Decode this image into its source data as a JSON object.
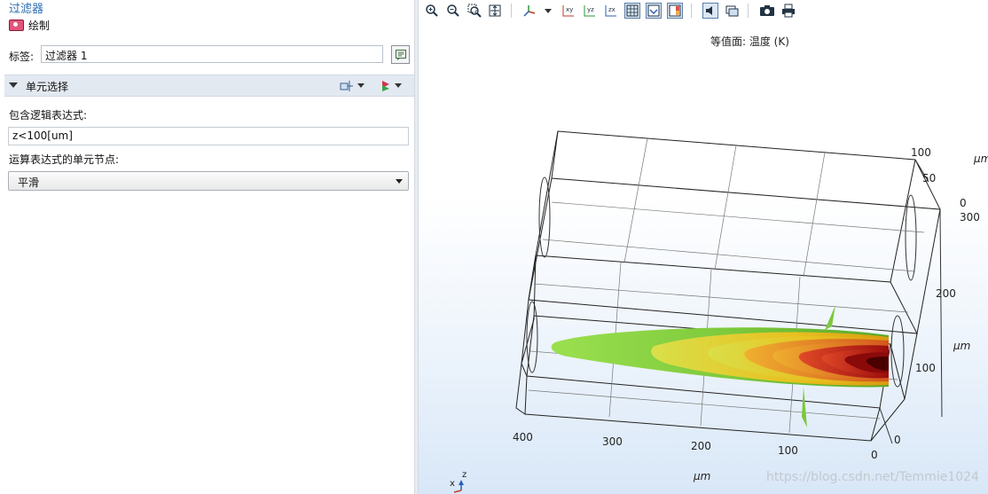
{
  "settings": {
    "panel_title": "过滤器",
    "plot_button": "绘制",
    "label_caption": "标签:",
    "label_value": "过滤器 1",
    "section_title": "单元选择",
    "logical_expr_caption": "包含逻辑表达式:",
    "logical_expr_value": "z<100[um]",
    "node_caption": "运算表达式的单元节点:",
    "node_value": "平滑"
  },
  "plot": {
    "title": "等值面: 温度 (K)",
    "x_ticks": [
      "400",
      "300",
      "200",
      "100",
      "0"
    ],
    "x_unit": "μm",
    "y_ticks": [
      "300",
      "200",
      "100",
      "0"
    ],
    "y_unit": "μm",
    "z_ticks": [
      "100",
      "50",
      "0"
    ],
    "z_unit": "μm",
    "axis_labels": {
      "z": "z",
      "x": "x"
    },
    "watermark": "https://blog.csdn.net/Temmie1024"
  },
  "toolbar": {
    "icons": [
      "zoom-in-icon",
      "zoom-out-icon",
      "zoom-box-icon",
      "zoom-extents-icon",
      "rotate-axes-icon",
      "xy-plane-icon",
      "yz-plane-icon",
      "zx-plane-icon",
      "grid-toggle-icon",
      "transparency-icon",
      "colorbar-icon",
      "scene-light-icon",
      "clear-icon",
      "snapshot-camera-icon",
      "print-icon"
    ]
  },
  "colors": {
    "panel_title": "#2d6db3",
    "section_bg": "#e3e9f1",
    "iso_low": "#8fd43f",
    "iso_high": "#8b0000"
  }
}
